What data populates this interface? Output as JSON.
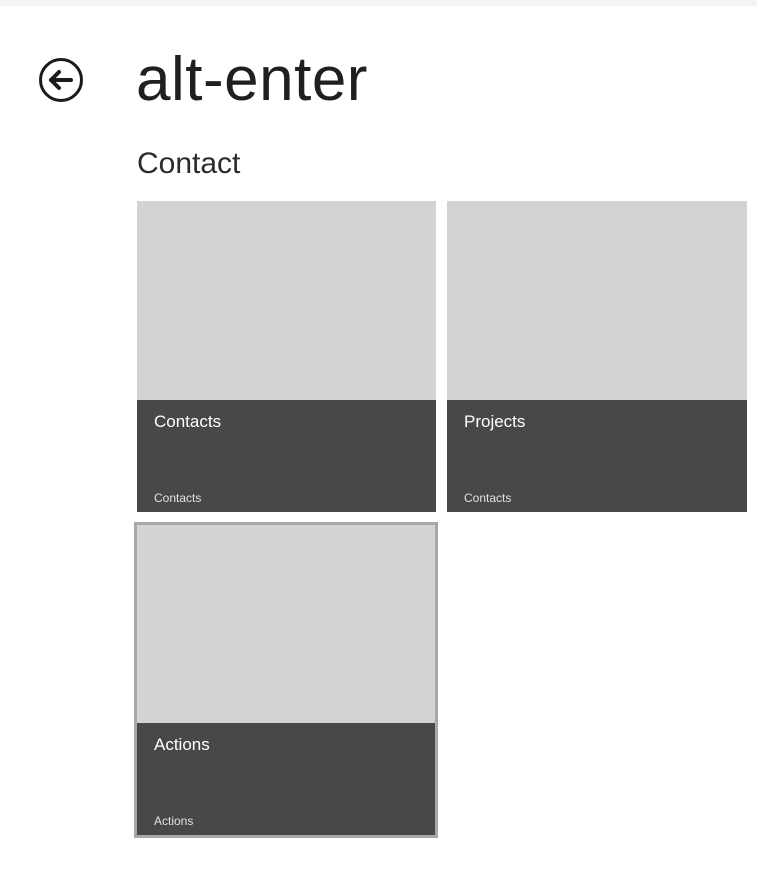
{
  "header": {
    "back_icon": "back-arrow-icon",
    "title": "alt-enter"
  },
  "section": {
    "title": "Contact"
  },
  "tiles": [
    {
      "title": "Contacts",
      "subtitle": "Contacts"
    },
    {
      "title": "Projects",
      "subtitle": "Contacts"
    },
    {
      "title": "Actions",
      "subtitle": "Actions",
      "selected": true
    }
  ],
  "colors": {
    "tile_image": "#d2d3d5",
    "tile_overlay": "#474848",
    "selection_border": "#a6a8a9",
    "background": "#ffffff"
  }
}
